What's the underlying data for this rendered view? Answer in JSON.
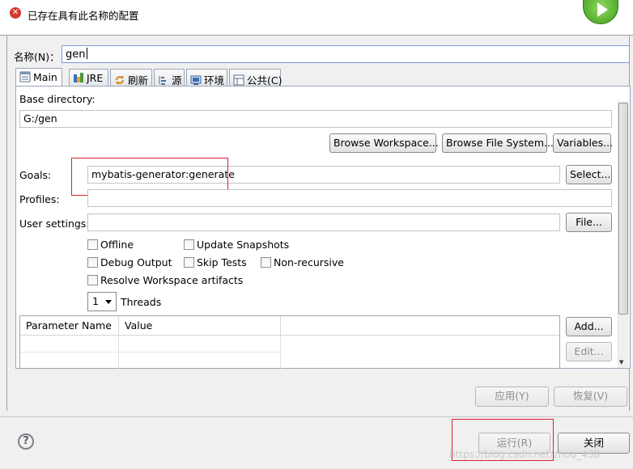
{
  "header": {
    "message": "已存在具有此名称的配置",
    "error_icon_glyph": "✕"
  },
  "name": {
    "label": "名称(N)：",
    "value": "gen"
  },
  "tabs": [
    {
      "label": "Main",
      "icon": "main-tab-icon"
    },
    {
      "label": "JRE",
      "icon": "jre-icon"
    },
    {
      "label": "刷新",
      "icon": "refresh-icon"
    },
    {
      "label": "源",
      "icon": "source-icon"
    },
    {
      "label": "环境",
      "icon": "environment-icon"
    },
    {
      "label": "公共(C)",
      "icon": "common-icon"
    }
  ],
  "main": {
    "base_directory_label": "Base directory:",
    "base_directory_value": "G:/gen",
    "browse_workspace": "Browse Workspace...",
    "browse_file_system": "Browse File System...",
    "variables": "Variables...",
    "goals_label": "Goals:",
    "goals_value": "mybatis-generator:generate",
    "select": "Select...",
    "profiles_label": "Profiles:",
    "profiles_value": "",
    "user_settings_label": "User settings:",
    "user_settings_value": "",
    "file": "File...",
    "checkboxes": {
      "offline": "Offline",
      "update_snapshots": "Update Snapshots",
      "debug_output": "Debug Output",
      "skip_tests": "Skip Tests",
      "non_recursive": "Non-recursive",
      "resolve_workspace": "Resolve Workspace artifacts"
    },
    "threads_value": "1",
    "threads_label": "Threads",
    "table": {
      "headers": [
        "Parameter Name",
        "Value"
      ]
    },
    "add": "Add...",
    "edit": "Edit..."
  },
  "footer": {
    "apply": "应用(Y)",
    "revert": "恢复(V)",
    "run": "运行(R)",
    "close": "关闭",
    "help_glyph": "?",
    "watermark": "https://blog.csdn.net/zhou_438"
  },
  "colors": {
    "highlight": "#d9232d",
    "run_icon": "#4caf23"
  }
}
